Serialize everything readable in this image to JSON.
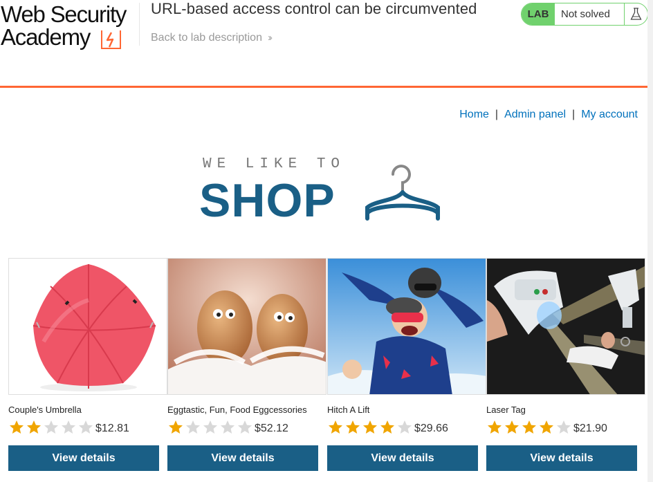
{
  "header": {
    "logo_line1": "Web Security",
    "logo_line2": "Academy",
    "lab_title": "URL-based access control can be circumvented",
    "back_link": "Back to lab description",
    "lab_tag": "LAB",
    "lab_status": "Not solved"
  },
  "nav": {
    "home": "Home",
    "separator": "|",
    "admin": "Admin panel",
    "account": "My account"
  },
  "banner": {
    "tagline": "WE LIKE TO",
    "shop": "SHOP"
  },
  "products": [
    {
      "name": "Couple's Umbrella",
      "rating": 2,
      "max_rating": 5,
      "price": "$12.81",
      "button": "View details",
      "image": "red-umbrella"
    },
    {
      "name": "Eggtastic, Fun, Food Eggcessories",
      "rating": 1,
      "max_rating": 5,
      "price": "$52.12",
      "button": "View details",
      "image": "eggs-with-eyes"
    },
    {
      "name": "Hitch A Lift",
      "rating": 4,
      "max_rating": 5,
      "price": "$29.66",
      "button": "View details",
      "image": "tandem-skydiving"
    },
    {
      "name": "Laser Tag",
      "rating": 4,
      "max_rating": 5,
      "price": "$21.90",
      "button": "View details",
      "image": "laser-tag-guns"
    }
  ],
  "colors": {
    "accent_orange": "#ff6633",
    "brand_blue": "#1a5f86",
    "link_blue": "#0071bc",
    "lab_green": "#70d16d",
    "star_filled": "#f0a500",
    "star_empty": "#d8d8d8"
  }
}
